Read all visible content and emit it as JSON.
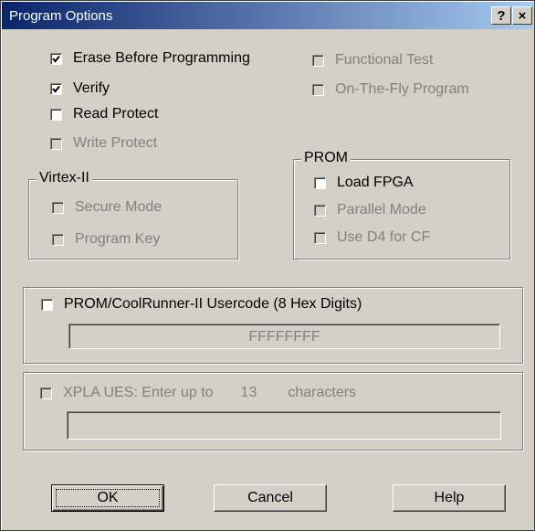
{
  "window": {
    "title": "Program Options",
    "help_glyph": "?",
    "close_glyph": "×"
  },
  "checkboxes": {
    "erase": {
      "label": "Erase Before Programming",
      "checked": true,
      "enabled": true
    },
    "verify": {
      "label": "Verify",
      "checked": true,
      "enabled": true
    },
    "read_protect": {
      "label": "Read Protect",
      "checked": false,
      "enabled": true
    },
    "write_protect": {
      "label": "Write Protect",
      "checked": false,
      "enabled": false
    },
    "functional_test": {
      "label": "Functional Test",
      "checked": false,
      "enabled": false
    },
    "on_the_fly": {
      "label": "On-The-Fly Program",
      "checked": false,
      "enabled": false
    }
  },
  "virtex": {
    "title": "Virtex-II",
    "secure_mode": {
      "label": "Secure Mode",
      "checked": false,
      "enabled": false
    },
    "program_key": {
      "label": "Program Key",
      "checked": false,
      "enabled": false
    }
  },
  "prom": {
    "title": "PROM",
    "load_fpga": {
      "label": "Load FPGA",
      "checked": false,
      "enabled": true
    },
    "parallel_mode": {
      "label": "Parallel Mode",
      "checked": false,
      "enabled": false
    },
    "use_d4": {
      "label": "Use D4 for CF",
      "checked": false,
      "enabled": false
    }
  },
  "usercode": {
    "label": "PROM/CoolRunner-II Usercode (8 Hex Digits)",
    "checked": false,
    "value": "FFFFFFFF"
  },
  "xpla": {
    "label": "XPLA UES: Enter up to",
    "count": "13",
    "suffix": "characters",
    "checked": false,
    "enabled": false,
    "value": ""
  },
  "buttons": {
    "ok": "OK",
    "cancel": "Cancel",
    "help": "Help"
  }
}
